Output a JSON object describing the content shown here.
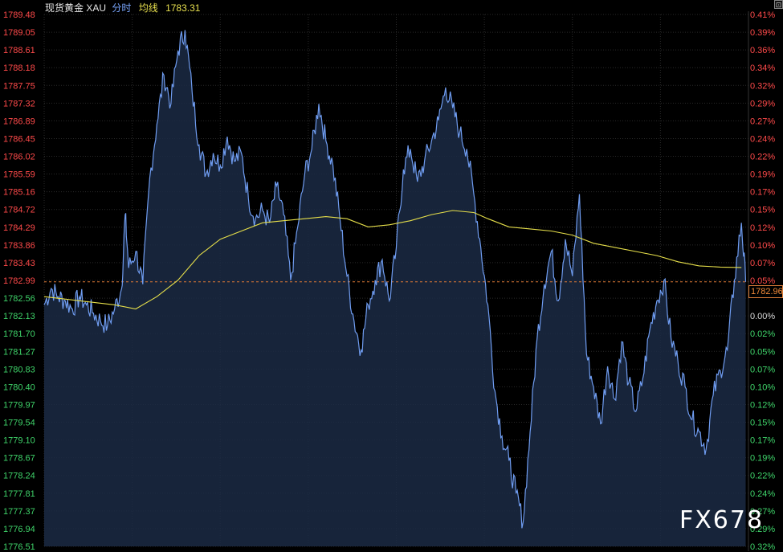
{
  "header": {
    "symbol": "现货黄金 XAU",
    "mode": "分时",
    "avg_label": "均线",
    "avg_value": "1783.31",
    "corner_glyph": "⊡"
  },
  "current_price_badge": "1782.96",
  "watermark": "FX678",
  "colors": {
    "background": "#000000",
    "price_line": "#6f9cf0",
    "price_fill": "#1b2a44",
    "average_line": "#e6df4a",
    "up": "#ff4a4a",
    "down": "#3fd46a",
    "grid": "#2a2a2a",
    "ref_line": "#e07a35"
  },
  "chart_data": {
    "type": "line",
    "reference_price": 1782.96,
    "ylim": [
      1776.51,
      1789.48
    ],
    "y_ticks": [
      "1789.48",
      "1789.05",
      "1788.61",
      "1788.18",
      "1787.75",
      "1787.32",
      "1786.89",
      "1786.45",
      "1786.02",
      "1785.59",
      "1785.16",
      "1784.72",
      "1784.29",
      "1783.86",
      "1783.43",
      "1782.99",
      "1782.56",
      "1782.13",
      "1781.70",
      "1781.27",
      "1780.83",
      "1780.40",
      "1779.97",
      "1779.54",
      "1779.10",
      "1778.67",
      "1778.24",
      "1777.81",
      "1777.37",
      "1776.94",
      "1776.51"
    ],
    "pct_ticks": [
      "0.41%",
      "0.39%",
      "0.36%",
      "0.34%",
      "0.32%",
      "0.29%",
      "0.27%",
      "0.24%",
      "0.22%",
      "0.19%",
      "0.17%",
      "0.15%",
      "0.12%",
      "0.10%",
      "0.07%",
      "0.05%",
      "",
      "0.00%",
      "0.02%",
      "0.05%",
      "0.07%",
      "0.10%",
      "0.12%",
      "0.15%",
      "0.17%",
      "0.19%",
      "0.22%",
      "0.24%",
      "0.27%",
      "0.29%",
      "0.32%"
    ],
    "xlim": [
      0,
      100
    ],
    "series": [
      {
        "values": [
          [
            0,
            1782.4
          ],
          [
            1,
            1782.8
          ],
          [
            2,
            1782.6
          ],
          [
            3,
            1782.5
          ],
          [
            4,
            1782.3
          ],
          [
            5,
            1782.6
          ],
          [
            6,
            1782.4
          ],
          [
            7,
            1782.2
          ],
          [
            8,
            1782.0
          ],
          [
            9,
            1781.9
          ],
          [
            10,
            1782.3
          ],
          [
            11,
            1782.8
          ],
          [
            11.5,
            1784.6
          ],
          [
            12,
            1783.3
          ],
          [
            13,
            1783.7
          ],
          [
            14,
            1782.9
          ],
          [
            15,
            1785.5
          ],
          [
            16,
            1786.8
          ],
          [
            17,
            1788.0
          ],
          [
            18,
            1787.3
          ],
          [
            19,
            1788.6
          ],
          [
            20,
            1789.1
          ],
          [
            21,
            1787.6
          ],
          [
            22,
            1786.3
          ],
          [
            23,
            1785.6
          ],
          [
            24,
            1786.1
          ],
          [
            25,
            1785.8
          ],
          [
            26,
            1786.5
          ],
          [
            27,
            1785.9
          ],
          [
            28,
            1786.1
          ],
          [
            29,
            1785.0
          ],
          [
            30,
            1784.5
          ],
          [
            31,
            1784.7
          ],
          [
            32,
            1784.4
          ],
          [
            33,
            1785.3
          ],
          [
            34,
            1784.6
          ],
          [
            35,
            1783.0
          ],
          [
            36,
            1784.3
          ],
          [
            37,
            1785.6
          ],
          [
            38,
            1786.2
          ],
          [
            39,
            1787.3
          ],
          [
            40,
            1786.4
          ],
          [
            41,
            1785.8
          ],
          [
            42,
            1784.5
          ],
          [
            43,
            1783.1
          ],
          [
            44,
            1782.0
          ],
          [
            45,
            1781.3
          ],
          [
            46,
            1782.4
          ],
          [
            47,
            1783.0
          ],
          [
            48,
            1783.5
          ],
          [
            49,
            1782.5
          ],
          [
            50,
            1783.8
          ],
          [
            51,
            1785.7
          ],
          [
            52,
            1786.2
          ],
          [
            53,
            1785.4
          ],
          [
            54,
            1785.9
          ],
          [
            55,
            1786.4
          ],
          [
            56,
            1786.9
          ],
          [
            57,
            1787.7
          ],
          [
            58,
            1787.2
          ],
          [
            59,
            1786.6
          ],
          [
            60,
            1786.2
          ],
          [
            61,
            1785.1
          ],
          [
            62,
            1783.8
          ],
          [
            63,
            1782.4
          ],
          [
            64,
            1780.3
          ],
          [
            65,
            1779.2
          ],
          [
            66,
            1778.6
          ],
          [
            67,
            1777.8
          ],
          [
            68,
            1777.1
          ],
          [
            69,
            1779.3
          ],
          [
            70,
            1781.6
          ],
          [
            71,
            1782.9
          ],
          [
            72,
            1783.7
          ],
          [
            73,
            1782.5
          ],
          [
            74,
            1784.0
          ],
          [
            75,
            1783.1
          ],
          [
            76,
            1785.1
          ],
          [
            77,
            1781.2
          ],
          [
            78,
            1780.4
          ],
          [
            79,
            1779.5
          ],
          [
            80,
            1780.9
          ],
          [
            81,
            1780.1
          ],
          [
            82,
            1781.5
          ],
          [
            83,
            1780.5
          ],
          [
            84,
            1779.8
          ],
          [
            85,
            1780.6
          ],
          [
            86,
            1781.8
          ],
          [
            87,
            1782.5
          ],
          [
            88,
            1783.0
          ],
          [
            89,
            1781.6
          ],
          [
            90,
            1781.0
          ],
          [
            91,
            1780.4
          ],
          [
            92,
            1779.6
          ],
          [
            93,
            1779.3
          ],
          [
            94,
            1778.9
          ],
          [
            95,
            1780.2
          ],
          [
            96,
            1780.8
          ],
          [
            97,
            1781.3
          ],
          [
            98,
            1783.0
          ],
          [
            99,
            1784.4
          ],
          [
            99.6,
            1782.96
          ]
        ]
      },
      {
        "values": [
          [
            0,
            1782.6
          ],
          [
            5,
            1782.5
          ],
          [
            10,
            1782.4
          ],
          [
            13,
            1782.3
          ],
          [
            16,
            1782.6
          ],
          [
            19,
            1783.0
          ],
          [
            22,
            1783.6
          ],
          [
            25,
            1784.0
          ],
          [
            28,
            1784.2
          ],
          [
            31,
            1784.4
          ],
          [
            34,
            1784.45
          ],
          [
            37,
            1784.5
          ],
          [
            40,
            1784.55
          ],
          [
            43,
            1784.5
          ],
          [
            46,
            1784.3
          ],
          [
            49,
            1784.35
          ],
          [
            52,
            1784.45
          ],
          [
            55,
            1784.6
          ],
          [
            58,
            1784.7
          ],
          [
            61,
            1784.65
          ],
          [
            63,
            1784.5
          ],
          [
            66,
            1784.3
          ],
          [
            69,
            1784.25
          ],
          [
            72,
            1784.2
          ],
          [
            75,
            1784.1
          ],
          [
            78,
            1783.9
          ],
          [
            81,
            1783.8
          ],
          [
            84,
            1783.7
          ],
          [
            87,
            1783.6
          ],
          [
            90,
            1783.45
          ],
          [
            93,
            1783.35
          ],
          [
            96,
            1783.32
          ],
          [
            99,
            1783.31
          ]
        ]
      }
    ]
  }
}
